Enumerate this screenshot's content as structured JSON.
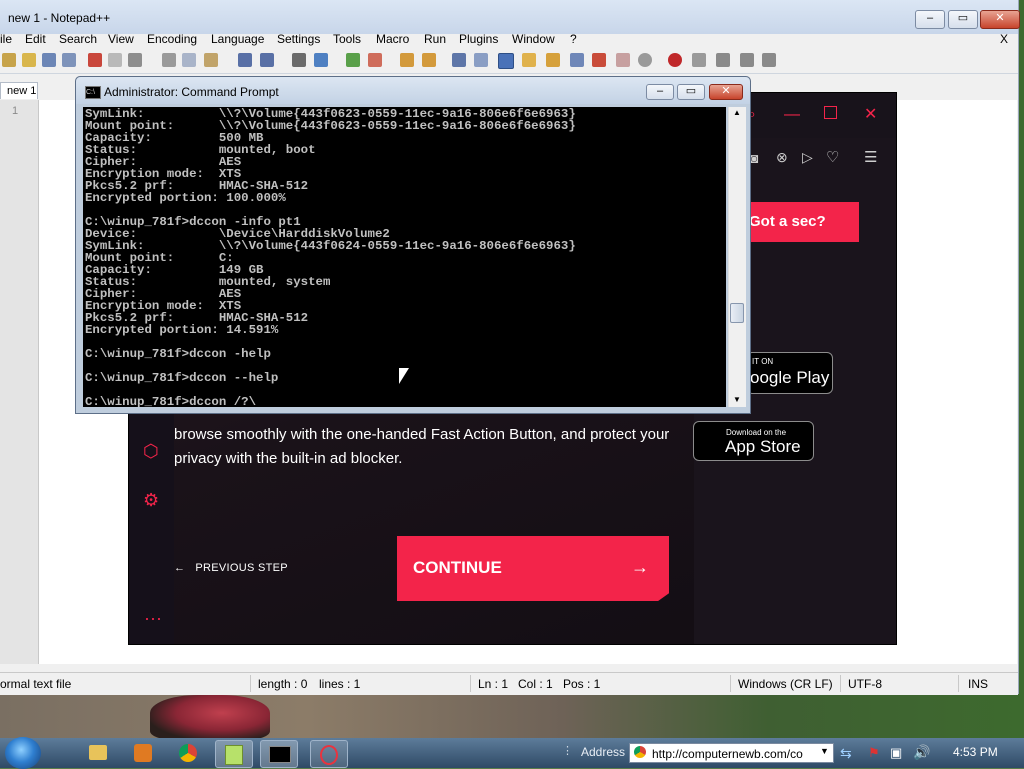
{
  "notepad": {
    "title": "new 1 - Notepad++",
    "menu": [
      "ile",
      "Edit",
      "Search",
      "View",
      "Encoding",
      "Language",
      "Settings",
      "Tools",
      "Macro",
      "Run",
      "Plugins",
      "Window",
      "?"
    ],
    "menu_close": "X",
    "tab": "new 1",
    "line_number": "1",
    "status": {
      "type": "ormal text file",
      "length": "length : 0",
      "lines": "lines : 1",
      "ln": "Ln : 1",
      "col": "Col : 1",
      "pos": "Pos : 1",
      "eol": "Windows (CR LF)",
      "encoding": "UTF-8",
      "mode": "INS"
    }
  },
  "cmd": {
    "title": "Administrator: Command Prompt",
    "lines": [
      "SymLink:          \\\\?\\Volume{443f0623-0559-11ec-9a16-806e6f6e6963}",
      "Mount point:      \\\\?\\Volume{443f0623-0559-11ec-9a16-806e6f6e6963}",
      "Capacity:         500 MB",
      "Status:           mounted, boot",
      "Cipher:           AES",
      "Encryption mode:  XTS",
      "Pkcs5.2 prf:      HMAC-SHA-512",
      "Encrypted portion: 100.000%",
      "",
      "C:\\winup_781f>dccon -info pt1",
      "Device:           \\Device\\HarddiskVolume2",
      "SymLink:          \\\\?\\Volume{443f0624-0559-11ec-9a16-806e6f6e6963}",
      "Mount point:      C:",
      "Capacity:         149 GB",
      "Status:           mounted, system",
      "Cipher:           AES",
      "Encryption mode:  XTS",
      "Pkcs5.2 prf:      HMAC-SHA-512",
      "Encrypted portion: 14.591%",
      "",
      "C:\\winup_781f>dccon -help",
      "",
      "C:\\winup_781f>dccon --help",
      "",
      "C:\\winup_781f>dccon /?\\"
    ]
  },
  "opera": {
    "got_sec": "Got a sec?",
    "google_play_small": "IT ON",
    "google_play_big": "oogle Play",
    "app_store_small": "Download on the",
    "app_store_big": "App Store",
    "description": "browse smoothly with the one-handed Fast Action Button, and protect your privacy with the built-in ad blocker.",
    "previous_step": "PREVIOUS STEP",
    "continue": "CONTINUE",
    "accent": "#f3244a"
  },
  "taskbar": {
    "address_label": "Address",
    "address_url": "http://computernewb.com/co",
    "clock": "4:53 PM"
  }
}
